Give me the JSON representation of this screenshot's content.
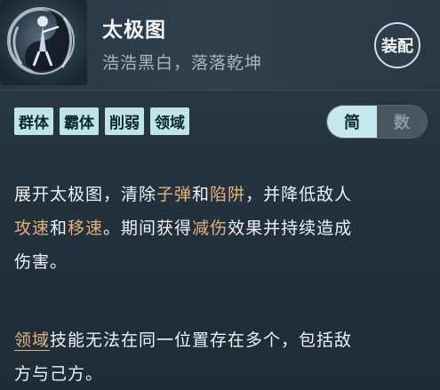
{
  "skill": {
    "title": "太极图",
    "subtitle": "浩浩黑白，落落乾坤",
    "icon": "taiji-swordsman-icon"
  },
  "equip_button": {
    "label": "装配"
  },
  "tags": [
    "群体",
    "霸体",
    "削弱",
    "领域"
  ],
  "mode_toggle": {
    "options": [
      "简",
      "数"
    ],
    "selected": "简"
  },
  "description": {
    "line1": [
      "展开太极图，清除",
      "子弹",
      "和",
      "陷阱",
      "，并降低敌人"
    ],
    "line2": [
      "攻速",
      "和",
      "移速",
      "。期间获得",
      "减伤",
      "效果并持续造成"
    ],
    "line3": "伤害。"
  },
  "note": {
    "keyword": "领域",
    "line1_rest": "技能无法在同一位置存在多个，包括敌",
    "line2": "方与己方。"
  },
  "colors": {
    "highlight": "#e3b27c",
    "tag_bg": "#bde4ea",
    "background": "#25333f"
  }
}
